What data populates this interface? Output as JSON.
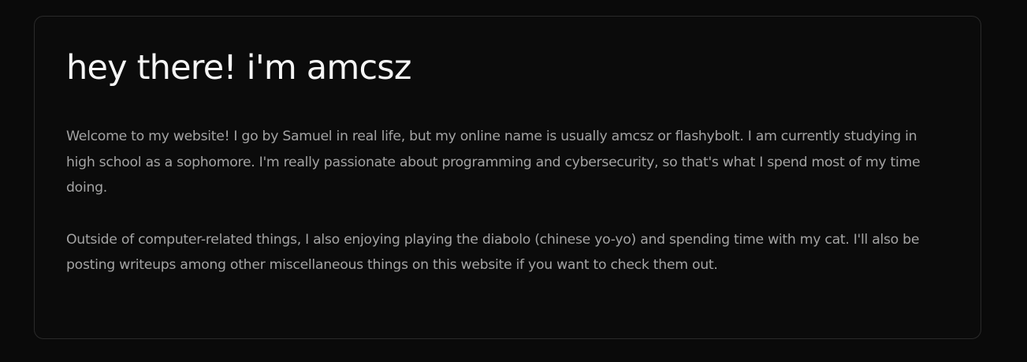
{
  "hero": {
    "title": "hey there! i'm amcsz",
    "paragraphs": [
      "Welcome to my website! I go by Samuel in real life, but my online name is usually amcsz or flashybolt. I am currently studying in high school as a sophomore. I'm really passionate about programming and cybersecurity, so that's what I spend most of my time doing.",
      "Outside of computer-related things, I also enjoying playing the diabolo (chinese yo-yo) and spending time with my cat. I'll also be posting writeups among other miscellaneous things on this website if you want to check them out."
    ]
  },
  "colors": {
    "background": "#0a0a0a",
    "card_border": "#2a2a2a",
    "title_text": "#f5f5f5",
    "body_text": "#a3a3a3"
  }
}
